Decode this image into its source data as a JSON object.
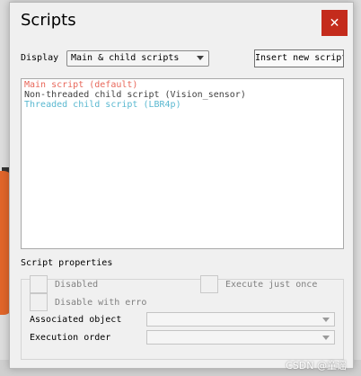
{
  "dialog": {
    "title": "Scripts",
    "close_label": "✕"
  },
  "toolbar": {
    "display_label": "Display",
    "display_value": "Main & child scripts",
    "insert_label": "Insert new script"
  },
  "scripts": [
    {
      "label": "Main script (default)",
      "color": "#e8675a"
    },
    {
      "label": "Non-threaded child script (Vision_sensor)",
      "color": "#404040"
    },
    {
      "label": "Threaded child script (LBR4p)",
      "color": "#5ab8d0"
    }
  ],
  "properties": {
    "title": "Script properties",
    "disabled_label": "Disabled",
    "execute_once_label": "Execute just once",
    "disable_with_error_label": "Disable with erro",
    "associated_object_label": "Associated object",
    "associated_object_value": "",
    "execution_order_label": "Execution order",
    "execution_order_value": ""
  },
  "watermark": "CSDN @童谣"
}
